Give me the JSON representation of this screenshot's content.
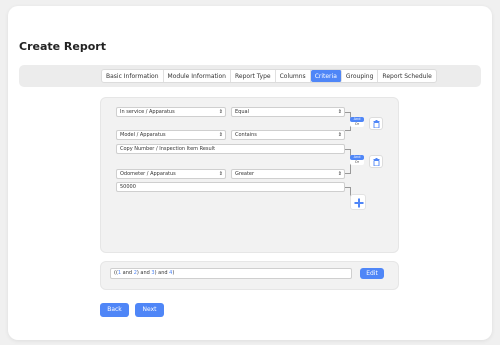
{
  "page": {
    "title": "Create Report"
  },
  "tabs": [
    {
      "label": "Basic Information",
      "active": false
    },
    {
      "label": "Module Information",
      "active": false
    },
    {
      "label": "Report Type",
      "active": false
    },
    {
      "label": "Columns",
      "active": false
    },
    {
      "label": "Criteria",
      "active": true
    },
    {
      "label": "Grouping",
      "active": false
    },
    {
      "label": "Report Schedule",
      "active": false
    }
  ],
  "criteria": [
    {
      "field": "In service / Apparatus",
      "operator": "Equal",
      "value": null
    },
    {
      "field": "Model / Apparatus",
      "operator": "Contains",
      "value": "Copy Number / Inspection Item Result"
    },
    {
      "field": "Odometer / Apparatus",
      "operator": "Greater",
      "value": "50000"
    }
  ],
  "connectors": {
    "and_label": "And",
    "or_label": "Or",
    "selected": "And"
  },
  "expression": {
    "parts": [
      "((",
      "1",
      " and ",
      "2",
      ") and ",
      "3",
      ") and ",
      "4",
      ")"
    ],
    "edit_label": "Edit"
  },
  "footer": {
    "back_label": "Back",
    "next_label": "Next"
  },
  "colors": {
    "accent": "#4f86f7",
    "panel": "#f2f2f2"
  },
  "icons": {
    "trash": "trash-icon",
    "add": "plus-icon",
    "select_arrow": "updown-arrow-icon"
  }
}
